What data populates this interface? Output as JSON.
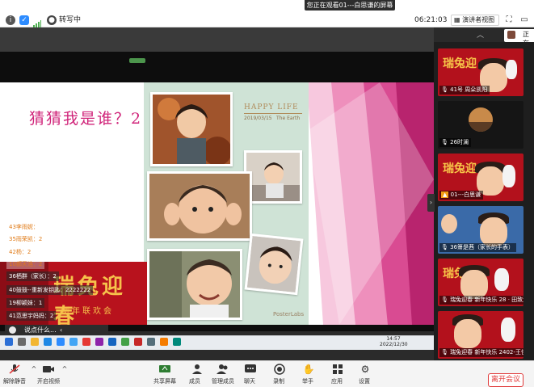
{
  "topbar": {
    "info_icon": "info-icon",
    "shield_icon": "shield-icon",
    "signal_icon": "signal-icon",
    "caption_label": "转写中",
    "share_banner": "您正在观看01---白思谦的屏幕",
    "share_more": "…",
    "timer": "06:21:03",
    "view_label": "演讲者视图",
    "colors": {
      "accent": "#2d8cff",
      "shield": "#2d8cff",
      "signal": "#4caf50"
    }
  },
  "slide": {
    "title": "猜猜我是谁？2",
    "happy_life": "HAPPY LIFE",
    "date": "2019/03/15",
    "place": "The Earth",
    "posterlabs": "PosterLabs",
    "banner_big": "瑞兔迎春",
    "banner_small": "新年联欢会"
  },
  "overlay_names": [
    {
      "text": "43李雨妮："
    },
    {
      "text": "35雨荣凯：2"
    },
    {
      "text": "42杨：2"
    },
    {
      "text": "10郝天浩：2"
    },
    {
      "text": "36栖群（家长）：2"
    },
    {
      "text": "40鼓鼓--重新发钥匙：2222222"
    },
    {
      "text": "19柳颖妹：1"
    },
    {
      "text": "41范思宇妈妈：2"
    }
  ],
  "chat": {
    "placeholder": "说点什么...",
    "arrow": "‹"
  },
  "taskbar": {
    "time": "14:57",
    "date": "2022/12/30"
  },
  "panel": {
    "self_label": "正在",
    "side_toggle": "›",
    "participants": [
      {
        "name": "41号 周朵凯阳",
        "mic": "mic-icon"
      },
      {
        "name": "26时澜",
        "mic": "mic-icon"
      },
      {
        "name": "01---白思谦",
        "mic": "mic-icon"
      },
      {
        "name": "36箫是茜（家长的手表）",
        "mic": "mic-icon"
      },
      {
        "name": "瑞兔迎春 新年快乐 28 · 田致远",
        "mic": "mic-icon"
      },
      {
        "name": "瑞兔迎春 新年快乐 2402-王佳琪",
        "mic": "mic-icon"
      }
    ],
    "tile_banner": "瑞兔迎"
  },
  "bottombar": {
    "items": [
      {
        "icon": "mic-icon",
        "label": "解除静音"
      },
      {
        "icon": "video-icon",
        "label": "开启视频"
      },
      {
        "icon": "share-screen-icon",
        "label": "共享屏幕"
      },
      {
        "icon": "participants-icon",
        "label": "成员"
      },
      {
        "icon": "manage-icon",
        "label": "管理成员"
      },
      {
        "icon": "chat-icon",
        "label": "聊天"
      },
      {
        "icon": "record-icon",
        "label": "录制"
      },
      {
        "icon": "hand-icon",
        "label": "举手"
      },
      {
        "icon": "apps-icon",
        "label": "应用"
      },
      {
        "icon": "settings-icon",
        "label": "设置"
      }
    ],
    "leave_label": "离开会议",
    "leave_color": "#e03a3a"
  }
}
